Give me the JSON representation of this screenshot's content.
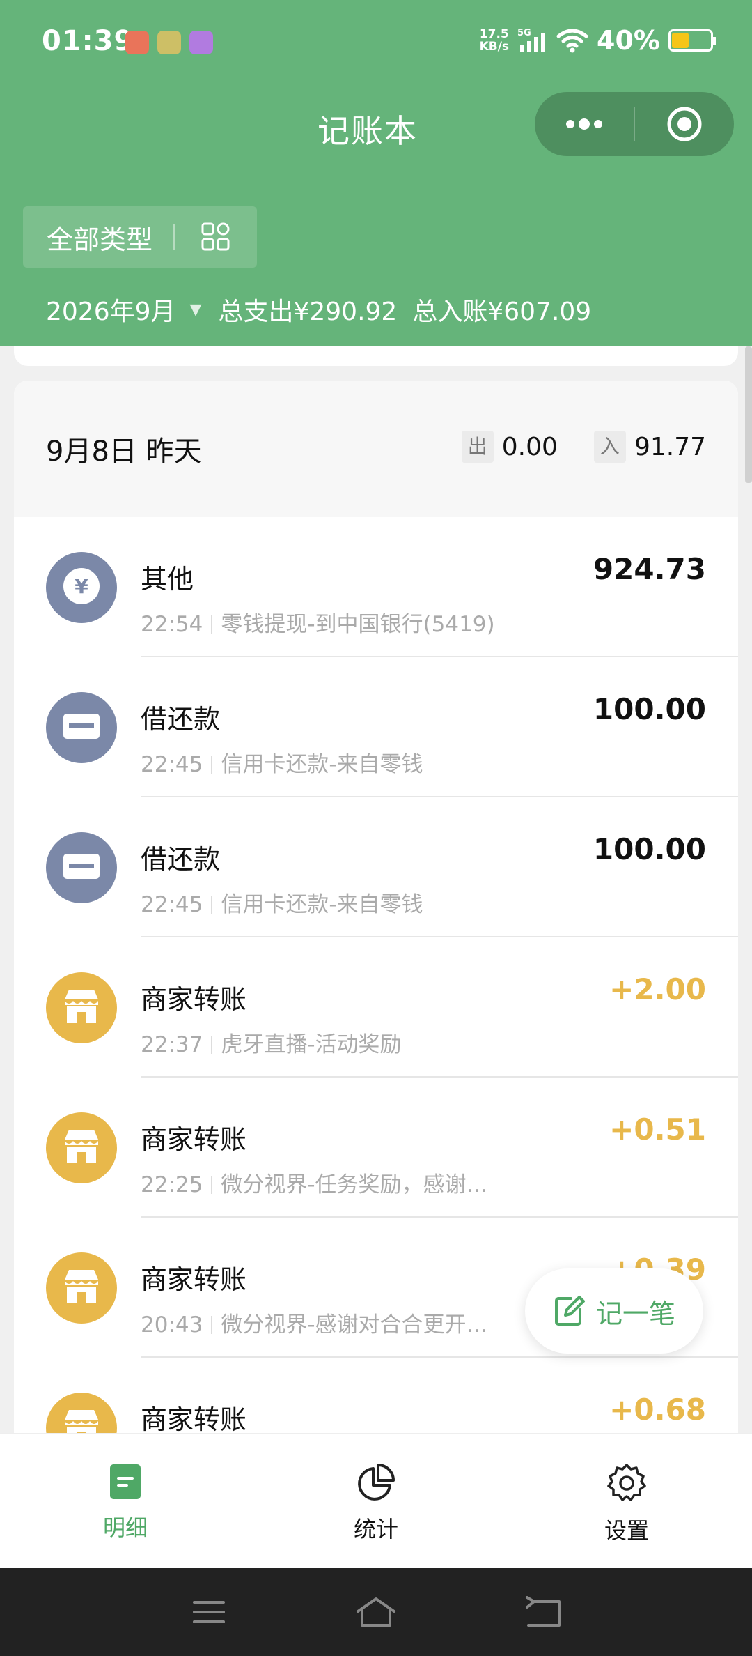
{
  "status_bar": {
    "time": "01:39",
    "net_speed_value": "17.5",
    "net_speed_unit": "KB/s",
    "network": "5G",
    "battery": "40%",
    "battery_level": 0.4
  },
  "header": {
    "title": "记账本",
    "type_filter": "全部类型",
    "month": "2026年9月",
    "total_expense": "总支出¥290.92",
    "total_income": "总入账¥607.09"
  },
  "day": {
    "date": "9月8日 昨天",
    "out_tag": "出",
    "out_value": "0.00",
    "in_tag": "入",
    "in_value": "91.77"
  },
  "transactions": [
    {
      "category": "其他",
      "time": "22:54",
      "desc": "零钱提现-到中国银行(5419)",
      "amount": "924.73",
      "type": "expense",
      "icon": "yuan-icon",
      "color": "#7b88a8"
    },
    {
      "category": "借还款",
      "time": "22:45",
      "desc": "信用卡还款-来自零钱",
      "amount": "100.00",
      "type": "expense",
      "icon": "card-icon",
      "color": "#7b88a8"
    },
    {
      "category": "借还款",
      "time": "22:45",
      "desc": "信用卡还款-来自零钱",
      "amount": "100.00",
      "type": "expense",
      "icon": "card-icon",
      "color": "#7b88a8"
    },
    {
      "category": "商家转账",
      "time": "22:37",
      "desc": "虎牙直播-活动奖励",
      "amount": "+2.00",
      "type": "income",
      "icon": "shop-icon",
      "color": "#e8b84b"
    },
    {
      "category": "商家转账",
      "time": "22:25",
      "desc": "微分视界-任务奖励，感谢…",
      "amount": "+0.51",
      "type": "income",
      "icon": "shop-icon",
      "color": "#e8b84b"
    },
    {
      "category": "商家转账",
      "time": "20:43",
      "desc": "微分视界-感谢对合合更开…",
      "amount": "+0.39",
      "type": "income",
      "icon": "shop-icon",
      "color": "#e8b84b"
    },
    {
      "category": "商家转账",
      "time": "",
      "desc": "",
      "amount": "+0.68",
      "type": "income",
      "icon": "shop-icon",
      "color": "#e8b84b"
    }
  ],
  "fab": {
    "label": "记一笔"
  },
  "tabs": [
    {
      "label": "明细",
      "icon": "detail-icon",
      "active": true
    },
    {
      "label": "统计",
      "icon": "pie-chart-icon",
      "active": false
    },
    {
      "label": "设置",
      "icon": "gear-icon",
      "active": false
    }
  ],
  "colors": {
    "header_bg": "#65b47a",
    "accent": "#4fa866",
    "income": "#e8b84b",
    "expense_icon": "#7b88a8"
  }
}
